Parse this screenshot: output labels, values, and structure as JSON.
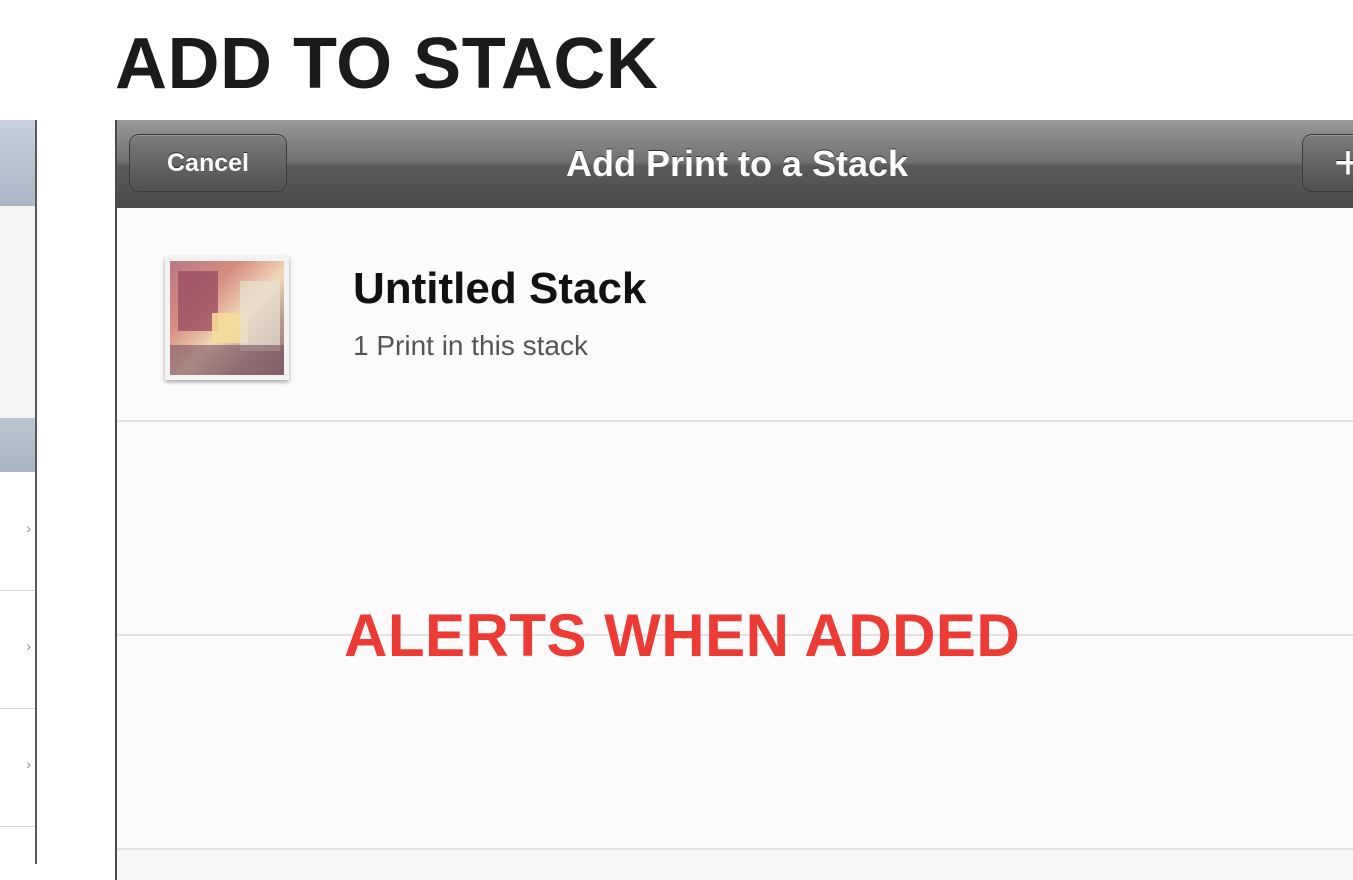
{
  "page": {
    "title": "ADD TO STACK",
    "annotation": "ALERTS WHEN ADDED"
  },
  "navbar": {
    "cancel_label": "Cancel",
    "title": "Add Print to a Stack",
    "add_label": "+"
  },
  "stacks": [
    {
      "name": "Untitled Stack",
      "count_text": "1 Print in this stack"
    }
  ],
  "colors": {
    "annotation": "#ec3a34",
    "navbar": "#5a5a5a"
  }
}
